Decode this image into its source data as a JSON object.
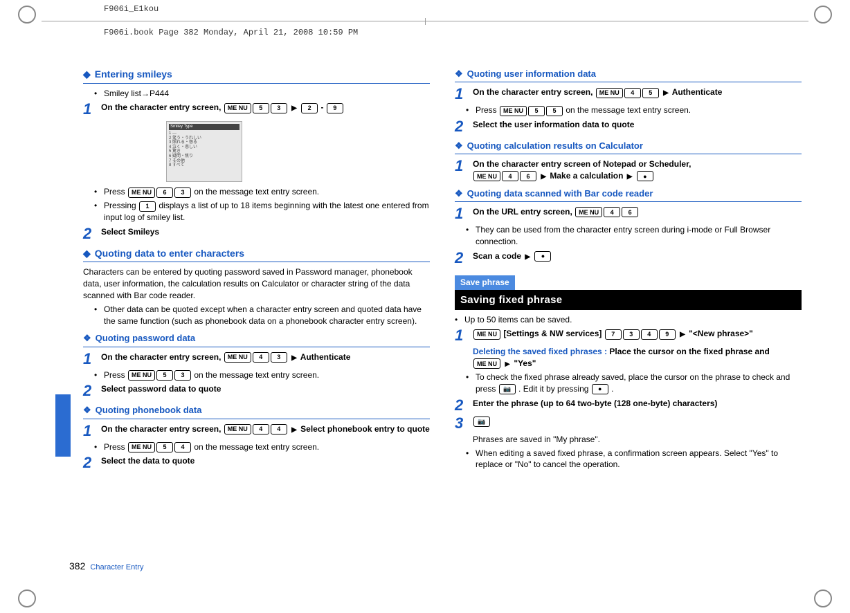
{
  "doc_header": "F906i_E1kou",
  "book_header": "F906i.book  Page 382  Monday, April 21, 2008  10:59 PM",
  "page_number": "382",
  "footer_label": "Character Entry",
  "left": {
    "h1": "Entering smileys",
    "ref1": "Smiley list→P444",
    "s1": "On the character entry screen, ",
    "s1_keys": [
      "ME NU",
      "5",
      "3"
    ],
    "s1_tail": "-",
    "s1_keys2": [
      "2"
    ],
    "s1_keys3": [
      "9"
    ],
    "screenshot_title": "Smiley Type",
    "screenshot_lines": [
      "1 ---",
      "2 笑う・うれしい",
      "3 照れる・怒る",
      "4 泣く・悲しい",
      "5 驚き",
      "6 疑問・焦り",
      "7 その他",
      "8 すべて"
    ],
    "b1": "Press ",
    "b1_keys": [
      "ME NU",
      "6",
      "3"
    ],
    "b1_tail": " on the message text entry screen.",
    "b2a": "Pressing ",
    "b2_key": "1",
    "b2b": " displays a list of up to 18 items beginning with the latest one entered from input log of smiley list.",
    "s2": "Select Smileys",
    "h2": "Quoting data to enter characters",
    "p1": "Characters can be entered by quoting password saved in Password manager, phonebook data, user information, the calculation results on Calculator or character string of the data scanned with Bar code reader.",
    "p2": "Other data can be quoted except when a character entry screen and quoted data have the same function (such as phonebook data on a phonebook character entry screen).",
    "sh1": "Quoting password data",
    "q1s1": "On the character entry screen, ",
    "q1_keys": [
      "ME NU",
      "4",
      "3"
    ],
    "q1_auth": "Authenticate",
    "q1b": "Press ",
    "q1b_keys": [
      "ME NU",
      "5",
      "3"
    ],
    "q1b_tail": " on the message text entry screen.",
    "q1s2": "Select password data to quote",
    "sh2": "Quoting phonebook data",
    "q2s1": "On the character entry screen, ",
    "q2_keys": [
      "ME NU",
      "4",
      "4"
    ],
    "q2_tail": "Select phonebook entry to quote",
    "q2b": "Press ",
    "q2b_keys": [
      "ME NU",
      "5",
      "4"
    ],
    "q2b_tail": " on the message text entry screen.",
    "q2s2": "Select the data to quote"
  },
  "right": {
    "sh1": "Quoting user information data",
    "u1": "On the character entry screen, ",
    "u1_keys": [
      "ME NU",
      "4",
      "5"
    ],
    "u1_auth": "Authenticate",
    "u1b": "Press ",
    "u1b_keys": [
      "ME NU",
      "5",
      "5"
    ],
    "u1b_tail": " on the message text entry screen.",
    "u2": "Select the user information data to quote",
    "sh2": "Quoting calculation results on Calculator",
    "c1": "On the character entry screen of Notepad or Scheduler, ",
    "c1_keys": [
      "ME NU",
      "4",
      "6"
    ],
    "c1_mid": "Make a calculation",
    "c1_end": "●",
    "sh3": "Quoting data scanned with Bar code reader",
    "bc1": "On the URL entry screen, ",
    "bc1_keys": [
      "ME NU",
      "4",
      "6"
    ],
    "bc1b": "They can be used from the character entry screen during i-mode or Full Browser connection.",
    "bc2": "Scan a code",
    "bc2_end": "●",
    "banner": "Save phrase",
    "big_title": "Saving fixed phrase",
    "sp_p1": "Up to 50 items can be saved.",
    "sp_s1a": " [Settings & NW services] ",
    "sp_s1_keys_pre": [
      "ME NU"
    ],
    "sp_s1_keys": [
      "7",
      "3",
      "4",
      "9"
    ],
    "sp_s1b": "\"<New phrase>\"",
    "del_label": "Deleting the saved fixed phrases : ",
    "del_body": "Place the cursor on the fixed phrase and ",
    "del_key": "ME NU",
    "del_yes": "\"Yes\"",
    "sp_b1a": "To check the fixed phrase already saved, place the cursor on the phrase to check and press ",
    "sp_b1_key1": "📷",
    "sp_b1b": ". Edit it by pressing ",
    "sp_b1_key2": "●",
    "sp_b1c": ".",
    "sp_s2": "Enter the phrase (up to 64 two-byte (128 one-byte) characters)",
    "sp_s3_key": "📷",
    "sp_p2": "Phrases are saved in \"My phrase\".",
    "sp_p3": "When editing a saved fixed phrase, a confirmation screen appears. Select \"Yes\" to replace or \"No\" to cancel the operation."
  }
}
